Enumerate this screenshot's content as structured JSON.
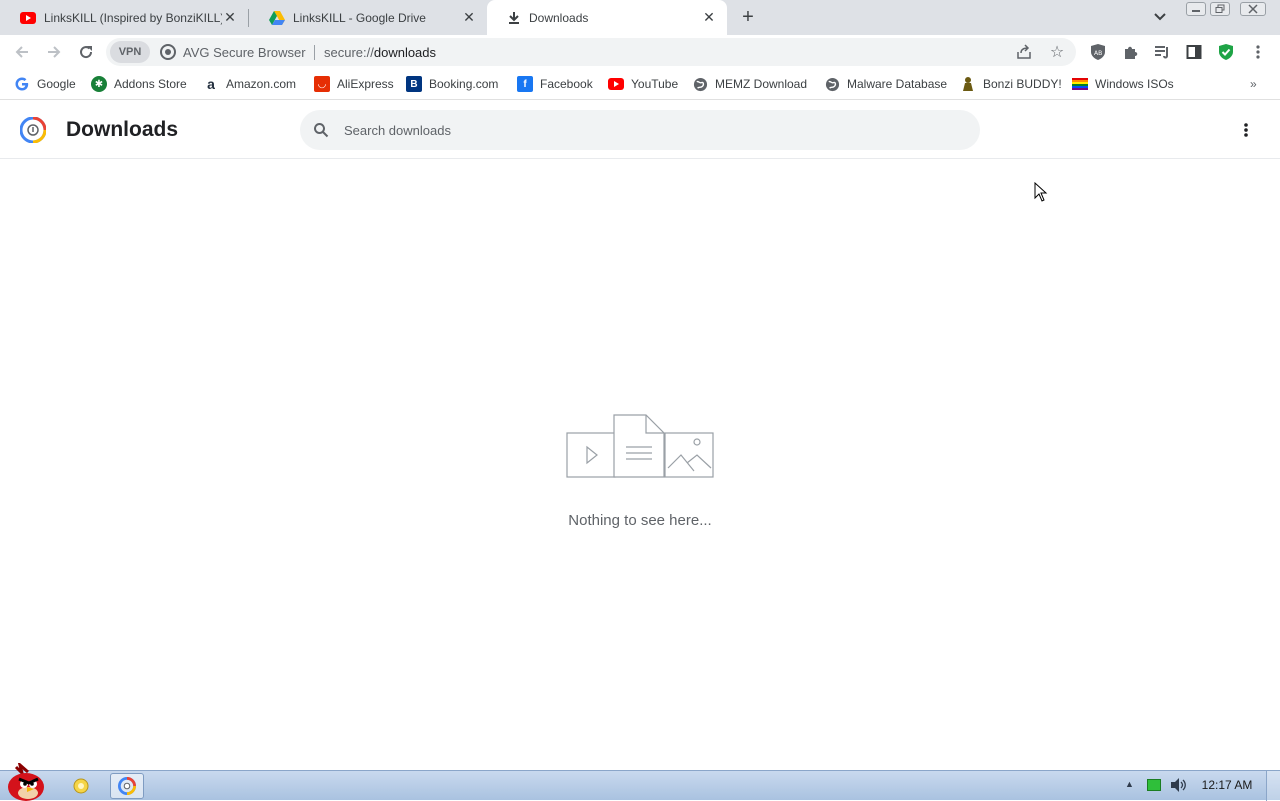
{
  "tabs": [
    {
      "title": "LinksKILL (Inspired by BonziKILL)",
      "icon": "youtube-icon"
    },
    {
      "title": "LinksKILL - Google Drive",
      "icon": "google-drive-icon"
    },
    {
      "title": "Downloads",
      "icon": "download-icon",
      "active": true
    }
  ],
  "toolbar": {
    "vpn_label": "VPN",
    "site_label": "AVG Secure Browser",
    "url_scheme": "secure://",
    "url_path": "downloads"
  },
  "bookmarks": [
    {
      "label": "Google",
      "icon": "google-icon",
      "color": "#4285f4"
    },
    {
      "label": "Addons Store",
      "icon": "addons-store-icon",
      "color": "#188038"
    },
    {
      "label": "Amazon.com",
      "icon": "amazon-icon",
      "color": "#232f3e"
    },
    {
      "label": "AliExpress",
      "icon": "aliexpress-icon",
      "color": "#e62e04"
    },
    {
      "label": "Booking.com",
      "icon": "booking-icon",
      "color": "#003580"
    },
    {
      "label": "Facebook",
      "icon": "facebook-icon",
      "color": "#1877f2"
    },
    {
      "label": "YouTube",
      "icon": "youtube-icon",
      "color": "#ff0000"
    },
    {
      "label": "MEMZ Download",
      "icon": "globe-icon",
      "color": "#5f6368"
    },
    {
      "label": "Malware Database",
      "icon": "globe-icon",
      "color": "#5f6368"
    },
    {
      "label": "Bonzi BUDDY!",
      "icon": "bonzi-icon",
      "color": "#6b5a12"
    },
    {
      "label": "Windows ISOs",
      "icon": "rainbow-flag-icon",
      "color": "#e40303"
    }
  ],
  "page": {
    "title": "Downloads",
    "search_placeholder": "Search downloads",
    "empty_message": "Nothing to see here..."
  },
  "taskbar": {
    "clock": "12:17 AM"
  }
}
